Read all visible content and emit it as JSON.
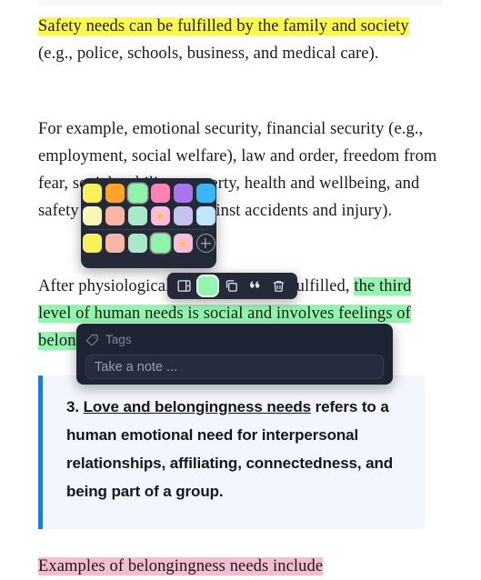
{
  "document": {
    "paragraphs": [
      {
        "id": "p-safety",
        "segments": [
          {
            "text": "Safety needs can be fulfilled by the family and society",
            "highlight": "yellow"
          },
          {
            "text": " (e.g., police, schools, business, and medical care).",
            "highlight": "none"
          }
        ]
      },
      {
        "id": "p-example",
        "segments": [
          {
            "text": "For example, emotional security, financial security (e.g., employment, social welfare), law and order, freedom from fear, social stability, property, health and wellbeing, and safety net (e.g., safety against accidents and injury).",
            "highlight": "none"
          }
        ]
      },
      {
        "id": "p-after",
        "segments": [
          {
            "text": "After physiological needs have been fulfilled, ",
            "highlight": "none"
          },
          {
            "text": "the third level of human needs is social and involves feelings of belongingness.",
            "highlight": "green"
          }
        ]
      },
      {
        "id": "p-examples-belonging",
        "segments": [
          {
            "text": "Examples of belongingness needs include",
            "highlight": "pink"
          }
        ]
      }
    ],
    "callout": {
      "number": "3.",
      "underlined_term": "Love and belongingness needs",
      "rest": " refers to a human emotional need for interpersonal relationships, affiliating, connectedness, and being part of a group.",
      "accent_color": "#1f7ae0",
      "background_color": "#f4f6fd"
    }
  },
  "highlight_colors": {
    "yellow": "#fbf94e",
    "green": "#94f5af",
    "pink": "#f4bdd0"
  },
  "palette_popup": {
    "panel_color": "#242a38",
    "rows": [
      {
        "name": "vivid-row",
        "swatches": [
          {
            "name": "swatch-yellow",
            "color": "#f9f155",
            "starred": false,
            "selected": false
          },
          {
            "name": "swatch-orange",
            "color": "#ffa52b",
            "starred": false,
            "selected": false
          },
          {
            "name": "swatch-green",
            "color": "#8ef5a8",
            "starred": false,
            "selected": true
          },
          {
            "name": "swatch-pink",
            "color": "#ff82b5",
            "starred": false,
            "selected": false
          },
          {
            "name": "swatch-purple",
            "color": "#a875ec",
            "starred": false,
            "selected": false
          },
          {
            "name": "swatch-blue",
            "color": "#3ab7f9",
            "starred": false,
            "selected": false
          }
        ]
      },
      {
        "name": "pastel-row",
        "swatches": [
          {
            "name": "swatch-pastel-yellow",
            "color": "#f9f7b8",
            "starred": false,
            "selected": false
          },
          {
            "name": "swatch-pastel-salmon",
            "color": "#f8b6a6",
            "starred": false,
            "selected": false
          },
          {
            "name": "swatch-pastel-mint",
            "color": "#a9e9c7",
            "starred": false,
            "selected": false
          },
          {
            "name": "swatch-pastel-pink",
            "color": "#f9bcdb",
            "starred": true,
            "selected": false
          },
          {
            "name": "swatch-pastel-lavender",
            "color": "#c5c2ef",
            "starred": false,
            "selected": false
          },
          {
            "name": "swatch-pastel-sky",
            "color": "#bfe7fb",
            "starred": false,
            "selected": false
          }
        ]
      },
      {
        "name": "recent-row",
        "swatches": [
          {
            "name": "swatch-recent-yellow",
            "color": "#f9f155",
            "starred": false,
            "selected": false
          },
          {
            "name": "swatch-recent-salmon",
            "color": "#f8b6a6",
            "starred": false,
            "selected": false
          },
          {
            "name": "swatch-recent-mint",
            "color": "#a9e9c7",
            "starred": false,
            "selected": false
          },
          {
            "name": "swatch-recent-green",
            "color": "#8ef5a8",
            "starred": false,
            "selected": true
          },
          {
            "name": "swatch-recent-pink",
            "color": "#f9bcdb",
            "starred": true,
            "selected": false
          }
        ],
        "add_button": "add-color-button"
      }
    ],
    "star_glyph": "★"
  },
  "toolbar": {
    "panel_color": "#242a38",
    "buttons": [
      {
        "name": "sidebar-toggle-button",
        "icon": "sidebar-icon",
        "label": "Open sidebar"
      },
      {
        "name": "highlight-color-button",
        "icon": "color-chip-icon",
        "label": "Highlight color",
        "color": "#94f5af",
        "active": true
      },
      {
        "name": "copy-button",
        "icon": "copy-icon",
        "label": "Copy"
      },
      {
        "name": "quote-button",
        "icon": "quote-icon",
        "label": "Quote"
      },
      {
        "name": "delete-button",
        "icon": "trash-icon",
        "label": "Delete"
      }
    ]
  },
  "note_panel": {
    "panel_color": "#1d2433",
    "tags_label": "Tags",
    "tags_icon": "tag-icon",
    "note_placeholder": "Take a note ...",
    "note_value": ""
  }
}
